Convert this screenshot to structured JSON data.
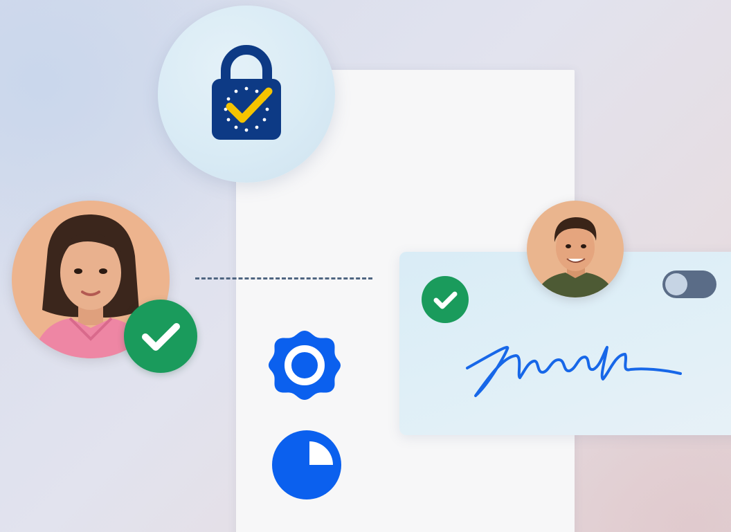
{
  "illustration": {
    "document": {},
    "security_badge": {
      "icon": "padlock-eu-stars-check-icon",
      "colors": {
        "lock": "#0d3a85",
        "stars": "#ffffff",
        "check": "#f5c400",
        "badge_bg": "#d9ebf5"
      }
    },
    "signer_left": {
      "avatar": "woman-avatar",
      "status": "verified",
      "status_icon": "checkmark-icon",
      "status_color": "#1a9b5c"
    },
    "signer_right": {
      "avatar": "man-avatar"
    },
    "signature_card": {
      "status": "verified",
      "status_icon": "checkmark-icon",
      "status_color": "#1a9b5c",
      "toggle": {
        "state": "off",
        "track_color": "#5a6c87",
        "knob_color": "#c6d4e4"
      },
      "signature_color": "#1767e8"
    },
    "status_icons": [
      {
        "name": "pending-badge-icon",
        "color": "#0b60ee"
      },
      {
        "name": "progress-pie-icon",
        "color": "#0b60ee",
        "progress": 0.25
      }
    ],
    "connector": {
      "style": "dashed",
      "color": "#4f6581"
    }
  }
}
